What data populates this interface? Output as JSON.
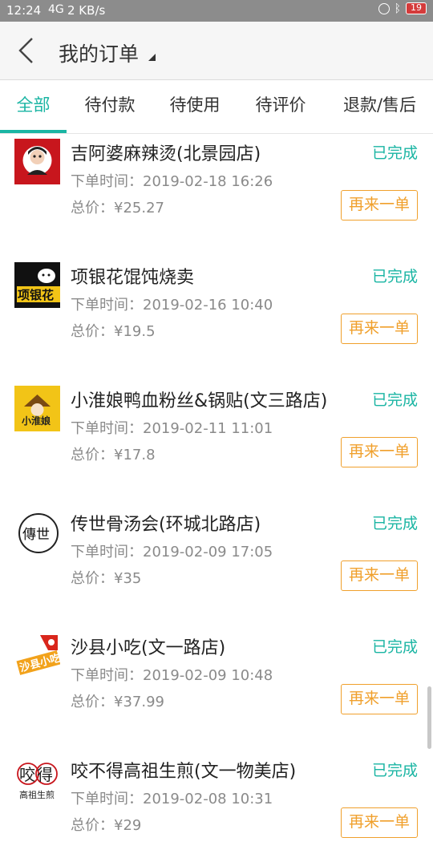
{
  "status_bar": {
    "time": "12:24",
    "network": "4G",
    "speed": "2 KB/s",
    "battery": "19"
  },
  "header": {
    "title": "我的订单"
  },
  "tabs": [
    {
      "label": "全部",
      "active": true
    },
    {
      "label": "待付款",
      "active": false
    },
    {
      "label": "待使用",
      "active": false
    },
    {
      "label": "待评价",
      "active": false
    },
    {
      "label": "退款/售后",
      "active": false
    }
  ],
  "orders": [
    {
      "store": "吉阿婆麻辣烫(北景园店)",
      "status": "已完成",
      "time_label": "下单时间：",
      "time": "2019-02-18 16:26",
      "price_label": "总价：",
      "price": "¥25.27",
      "action": "再来一单"
    },
    {
      "store": "项银花馄饨烧卖",
      "status": "已完成",
      "time_label": "下单时间：",
      "time": "2019-02-16 10:40",
      "price_label": "总价：",
      "price": "¥19.5",
      "action": "再来一单",
      "logo_text": "项银花"
    },
    {
      "store": "小淮娘鸭血粉丝&锅贴(文三路店)",
      "status": "已完成",
      "time_label": "下单时间：",
      "time": "2019-02-11 11:01",
      "price_label": "总价：",
      "price": "¥17.8",
      "action": "再来一单",
      "logo_text": "小淮娘"
    },
    {
      "store": "传世骨汤会(环城北路店)",
      "status": "已完成",
      "time_label": "下单时间：",
      "time": "2019-02-09 17:05",
      "price_label": "总价：",
      "price": "¥35",
      "action": "再来一单",
      "logo_text": "傳世"
    },
    {
      "store": "沙县小吃(文一路店)",
      "status": "已完成",
      "time_label": "下单时间：",
      "time": "2019-02-09 10:48",
      "price_label": "总价：",
      "price": "¥37.99",
      "action": "再来一单",
      "logo_text": "沙县小吃"
    },
    {
      "store": "咬不得高祖生煎(文一物美店)",
      "status": "已完成",
      "time_label": "下单时间：",
      "time": "2019-02-08 10:31",
      "price_label": "总价：",
      "price": "¥29",
      "action": "再来一单",
      "logo_text": "咬得",
      "logo_subtext": "高祖生煎"
    }
  ],
  "colors": {
    "accent": "#1ab5a3",
    "reorder": "#f0a02c",
    "status_bar": "#8c8c8c"
  }
}
